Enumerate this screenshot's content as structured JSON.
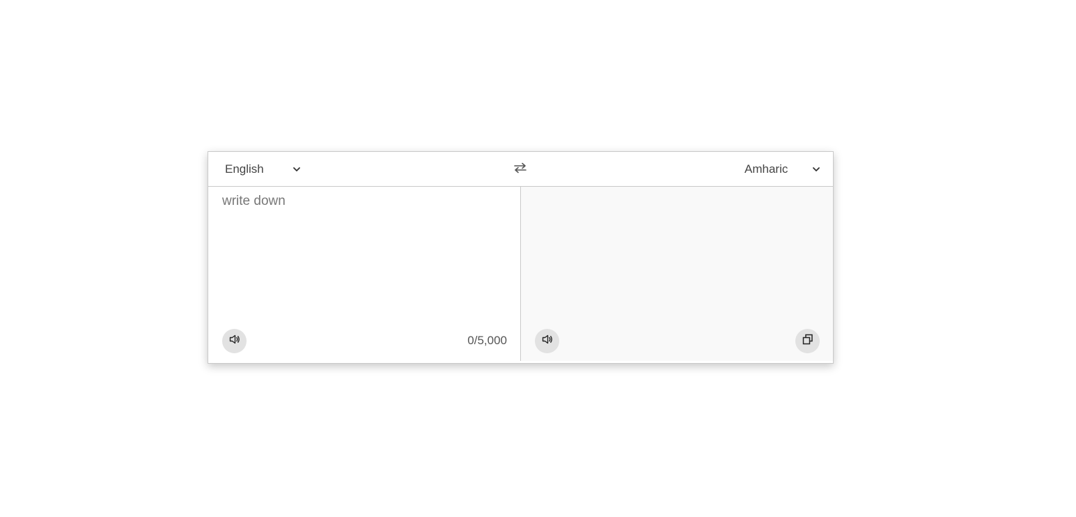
{
  "source": {
    "language": "English",
    "placeholder": "write down",
    "value": "",
    "char_count": "0/5,000"
  },
  "target": {
    "language": "Amharic",
    "value": ""
  },
  "icons": {
    "chevron": "chevron-down-icon",
    "swap": "swap-arrows-icon",
    "speaker": "speaker-icon",
    "copy": "copy-icon"
  },
  "colors": {
    "border": "#c9c9c9",
    "target_background": "#f9f9f9",
    "button_background": "#e2e2e2"
  }
}
